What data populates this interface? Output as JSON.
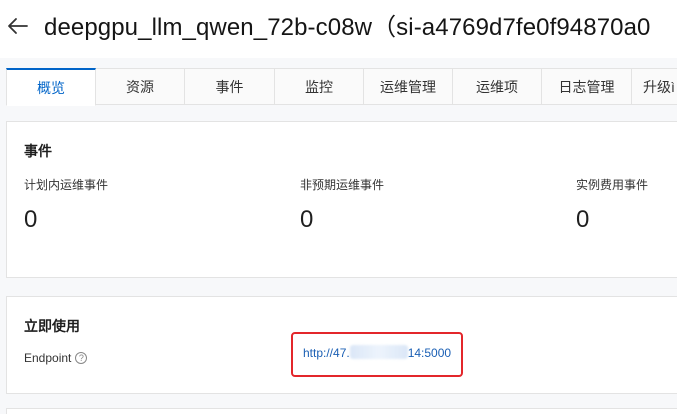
{
  "header": {
    "title": "deepgpu_llm_qwen_72b-c08w（si-a4769d7fe0f94870a0"
  },
  "tabs": [
    {
      "label": "概览",
      "active": true
    },
    {
      "label": "资源"
    },
    {
      "label": "事件"
    },
    {
      "label": "监控"
    },
    {
      "label": "运维管理"
    },
    {
      "label": "运维项"
    },
    {
      "label": "日志管理"
    },
    {
      "label": "升级ì"
    }
  ],
  "events": {
    "title": "事件",
    "stats": [
      {
        "label": "计划内运维事件",
        "value": "0"
      },
      {
        "label": "非预期运维事件",
        "value": "0"
      },
      {
        "label": "实例费用事件",
        "value": "0"
      }
    ]
  },
  "usage": {
    "title": "立即使用",
    "endpoint_label": "Endpoint",
    "endpoint_prefix": "http://47.",
    "endpoint_suffix": "14:5000"
  },
  "colors": {
    "accent": "#0064c8",
    "highlight_border": "#e3262b"
  }
}
